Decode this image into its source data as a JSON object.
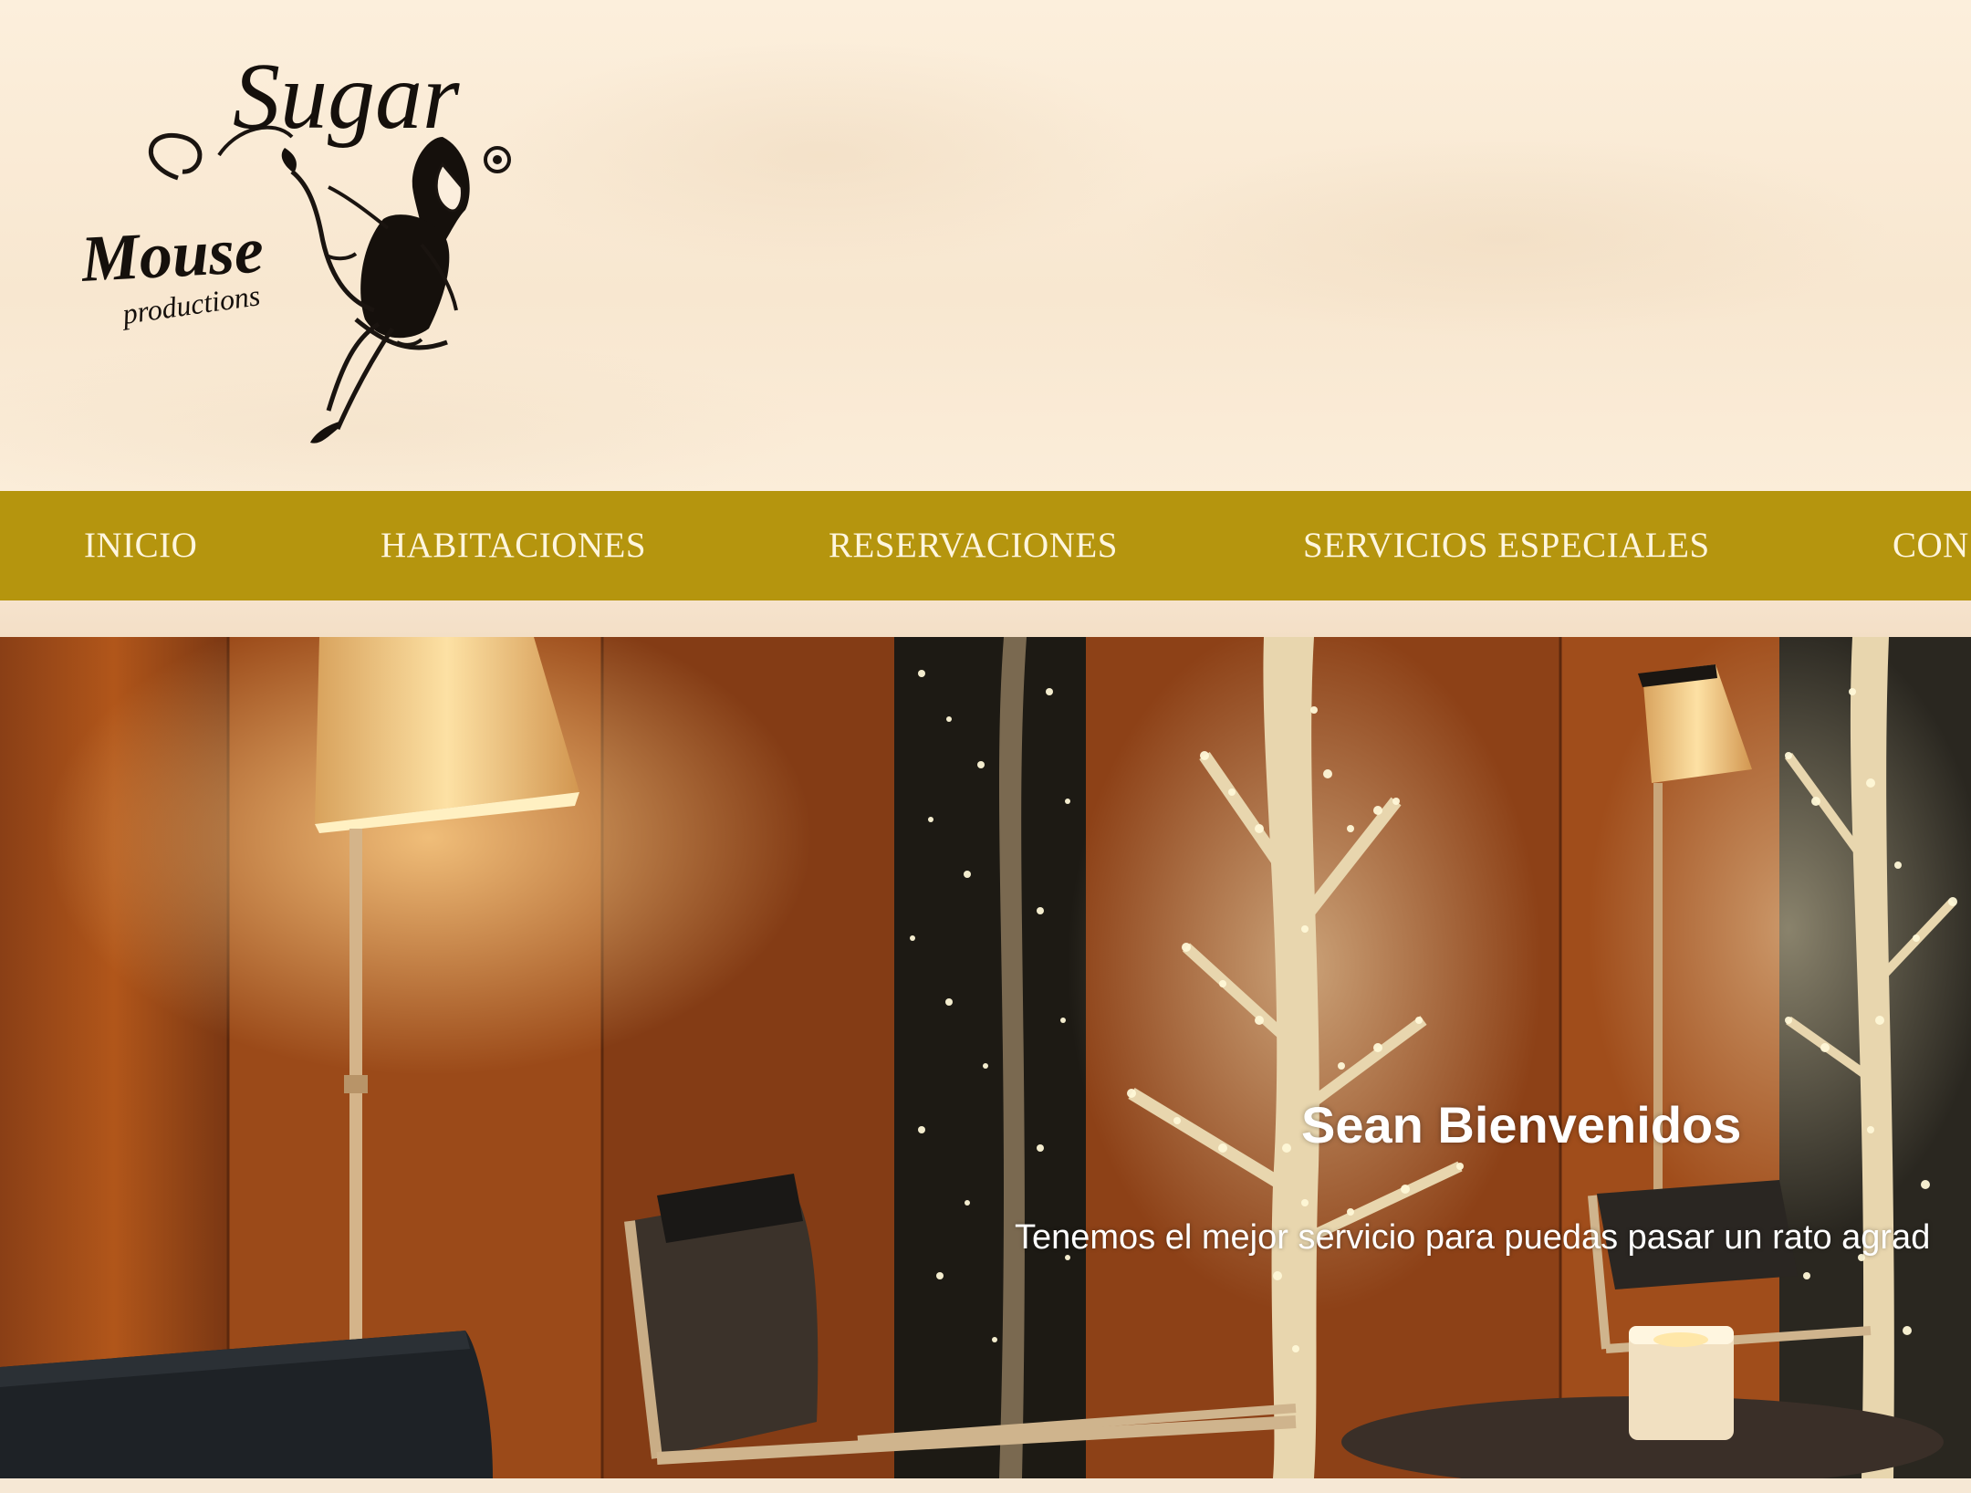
{
  "logo": {
    "line1": "Sugar",
    "line2": "Mouse",
    "line3": "productions"
  },
  "nav": {
    "items": [
      {
        "label": "INICIO"
      },
      {
        "label": "HABITACIONES"
      },
      {
        "label": "RESERVACIONES"
      },
      {
        "label": "SERVICIOS ESPECIALES"
      },
      {
        "label": "CON"
      }
    ]
  },
  "hero": {
    "title": "Sean Bienvenidos",
    "subtitle": "Tenemos el mejor servicio para puedas pasar un rato agrad"
  },
  "colors": {
    "nav_bg": "#b5950e",
    "nav_text": "#fff6de",
    "header_bg": "#fbeedd"
  }
}
